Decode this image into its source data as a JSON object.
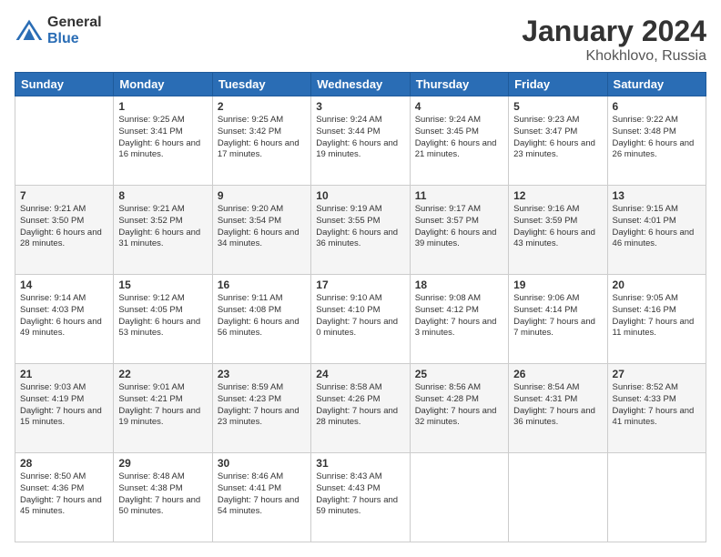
{
  "logo": {
    "general": "General",
    "blue": "Blue"
  },
  "header": {
    "month": "January 2024",
    "location": "Khokhlovo, Russia"
  },
  "weekdays": [
    "Sunday",
    "Monday",
    "Tuesday",
    "Wednesday",
    "Thursday",
    "Friday",
    "Saturday"
  ],
  "weeks": [
    [
      {
        "day": "",
        "sunrise": "",
        "sunset": "",
        "daylight": ""
      },
      {
        "day": "1",
        "sunrise": "9:25 AM",
        "sunset": "3:41 PM",
        "daylight": "6 hours and 16 minutes."
      },
      {
        "day": "2",
        "sunrise": "9:25 AM",
        "sunset": "3:42 PM",
        "daylight": "6 hours and 17 minutes."
      },
      {
        "day": "3",
        "sunrise": "9:24 AM",
        "sunset": "3:44 PM",
        "daylight": "6 hours and 19 minutes."
      },
      {
        "day": "4",
        "sunrise": "9:24 AM",
        "sunset": "3:45 PM",
        "daylight": "6 hours and 21 minutes."
      },
      {
        "day": "5",
        "sunrise": "9:23 AM",
        "sunset": "3:47 PM",
        "daylight": "6 hours and 23 minutes."
      },
      {
        "day": "6",
        "sunrise": "9:22 AM",
        "sunset": "3:48 PM",
        "daylight": "6 hours and 26 minutes."
      }
    ],
    [
      {
        "day": "7",
        "sunrise": "9:21 AM",
        "sunset": "3:50 PM",
        "daylight": "6 hours and 28 minutes."
      },
      {
        "day": "8",
        "sunrise": "9:21 AM",
        "sunset": "3:52 PM",
        "daylight": "6 hours and 31 minutes."
      },
      {
        "day": "9",
        "sunrise": "9:20 AM",
        "sunset": "3:54 PM",
        "daylight": "6 hours and 34 minutes."
      },
      {
        "day": "10",
        "sunrise": "9:19 AM",
        "sunset": "3:55 PM",
        "daylight": "6 hours and 36 minutes."
      },
      {
        "day": "11",
        "sunrise": "9:17 AM",
        "sunset": "3:57 PM",
        "daylight": "6 hours and 39 minutes."
      },
      {
        "day": "12",
        "sunrise": "9:16 AM",
        "sunset": "3:59 PM",
        "daylight": "6 hours and 43 minutes."
      },
      {
        "day": "13",
        "sunrise": "9:15 AM",
        "sunset": "4:01 PM",
        "daylight": "6 hours and 46 minutes."
      }
    ],
    [
      {
        "day": "14",
        "sunrise": "9:14 AM",
        "sunset": "4:03 PM",
        "daylight": "6 hours and 49 minutes."
      },
      {
        "day": "15",
        "sunrise": "9:12 AM",
        "sunset": "4:05 PM",
        "daylight": "6 hours and 53 minutes."
      },
      {
        "day": "16",
        "sunrise": "9:11 AM",
        "sunset": "4:08 PM",
        "daylight": "6 hours and 56 minutes."
      },
      {
        "day": "17",
        "sunrise": "9:10 AM",
        "sunset": "4:10 PM",
        "daylight": "7 hours and 0 minutes."
      },
      {
        "day": "18",
        "sunrise": "9:08 AM",
        "sunset": "4:12 PM",
        "daylight": "7 hours and 3 minutes."
      },
      {
        "day": "19",
        "sunrise": "9:06 AM",
        "sunset": "4:14 PM",
        "daylight": "7 hours and 7 minutes."
      },
      {
        "day": "20",
        "sunrise": "9:05 AM",
        "sunset": "4:16 PM",
        "daylight": "7 hours and 11 minutes."
      }
    ],
    [
      {
        "day": "21",
        "sunrise": "9:03 AM",
        "sunset": "4:19 PM",
        "daylight": "7 hours and 15 minutes."
      },
      {
        "day": "22",
        "sunrise": "9:01 AM",
        "sunset": "4:21 PM",
        "daylight": "7 hours and 19 minutes."
      },
      {
        "day": "23",
        "sunrise": "8:59 AM",
        "sunset": "4:23 PM",
        "daylight": "7 hours and 23 minutes."
      },
      {
        "day": "24",
        "sunrise": "8:58 AM",
        "sunset": "4:26 PM",
        "daylight": "7 hours and 28 minutes."
      },
      {
        "day": "25",
        "sunrise": "8:56 AM",
        "sunset": "4:28 PM",
        "daylight": "7 hours and 32 minutes."
      },
      {
        "day": "26",
        "sunrise": "8:54 AM",
        "sunset": "4:31 PM",
        "daylight": "7 hours and 36 minutes."
      },
      {
        "day": "27",
        "sunrise": "8:52 AM",
        "sunset": "4:33 PM",
        "daylight": "7 hours and 41 minutes."
      }
    ],
    [
      {
        "day": "28",
        "sunrise": "8:50 AM",
        "sunset": "4:36 PM",
        "daylight": "7 hours and 45 minutes."
      },
      {
        "day": "29",
        "sunrise": "8:48 AM",
        "sunset": "4:38 PM",
        "daylight": "7 hours and 50 minutes."
      },
      {
        "day": "30",
        "sunrise": "8:46 AM",
        "sunset": "4:41 PM",
        "daylight": "7 hours and 54 minutes."
      },
      {
        "day": "31",
        "sunrise": "8:43 AM",
        "sunset": "4:43 PM",
        "daylight": "7 hours and 59 minutes."
      },
      {
        "day": "",
        "sunrise": "",
        "sunset": "",
        "daylight": ""
      },
      {
        "day": "",
        "sunrise": "",
        "sunset": "",
        "daylight": ""
      },
      {
        "day": "",
        "sunrise": "",
        "sunset": "",
        "daylight": ""
      }
    ]
  ],
  "labels": {
    "sunrise_prefix": "Sunrise: ",
    "sunset_prefix": "Sunset: ",
    "daylight_prefix": "Daylight: "
  }
}
